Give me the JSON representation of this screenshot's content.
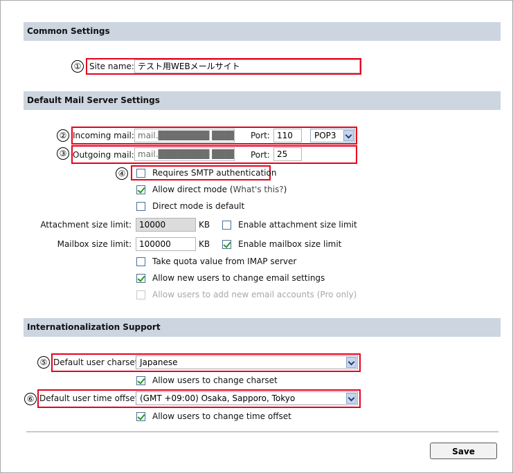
{
  "sections": {
    "common": "Common Settings",
    "mail": "Default Mail Server Settings",
    "i18n": "Internationalization Support"
  },
  "markers": [
    "①",
    "②",
    "③",
    "④",
    "⑤",
    "⑥"
  ],
  "site": {
    "label": "Site name:",
    "value": "テスト用WEBメールサイト"
  },
  "incoming": {
    "label": "Incoming mail:",
    "value": "mail.████████ ███████",
    "port_label": "Port:",
    "port": "110",
    "protocol": "POP3"
  },
  "outgoing": {
    "label": "Outgoing mail:",
    "value": "mail.████████ ███████",
    "port_label": "Port:",
    "port": "25"
  },
  "smtp_auth": {
    "label": "Requires SMTP authentication",
    "checked": false
  },
  "direct_mode": {
    "label": "Allow direct mode (",
    "link": "What's this?",
    "close": ")",
    "checked": true
  },
  "direct_default": {
    "label": "Direct mode is default",
    "checked": false
  },
  "attachment": {
    "label": "Attachment size limit:",
    "value": "10000",
    "unit": "KB",
    "enable_label": "Enable attachment size limit",
    "enabled": false
  },
  "mailbox": {
    "label": "Mailbox size limit:",
    "value": "100000",
    "unit": "KB",
    "enable_label": "Enable mailbox size limit",
    "enabled": true
  },
  "quota": {
    "label": "Take quota value from IMAP server",
    "checked": false
  },
  "change_email": {
    "label": "Allow new users to change email settings",
    "checked": true
  },
  "add_accounts": {
    "label": "Allow users to add new email accounts (Pro only)",
    "checked": false,
    "disabled": true
  },
  "charset": {
    "label": "Default user charset",
    "value": "Japanese"
  },
  "change_charset": {
    "label": "Allow users to change charset",
    "checked": true
  },
  "time_offset": {
    "label": "Default user time offset",
    "value": "(GMT +09:00) Osaka, Sapporo, Tokyo"
  },
  "change_time": {
    "label": "Allow users to change time offset",
    "checked": true
  },
  "save_label": "Save",
  "colors": {
    "section_bg": "#ccd5e0",
    "highlight": "#e6001e",
    "check": "#1f9a1f"
  }
}
